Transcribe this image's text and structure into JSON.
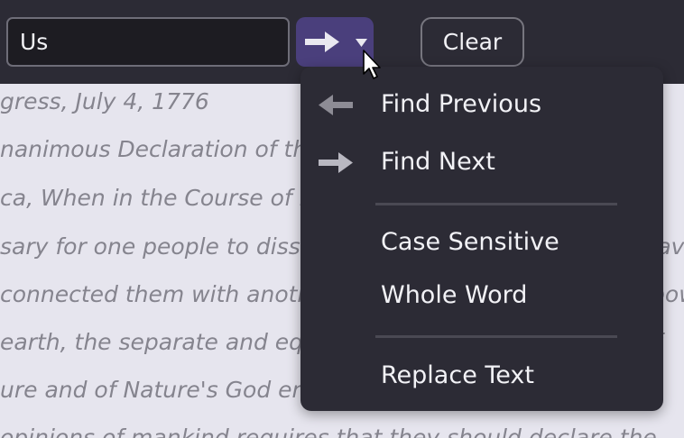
{
  "search": {
    "value": "Us"
  },
  "find_button": {
    "icon": "arrow-right-icon",
    "dropdown_icon": "caret-down-icon"
  },
  "clear_button": {
    "label": "Clear"
  },
  "document": {
    "lines": [
      "gress, July 4, 1776",
      "nanimous Declaration of the thirteen united States of",
      "ca, When in the Course of human events, it becomes",
      "sary for one people to dissolve the political bands which have",
      "connected them with another, and to assume among the powers of the",
      "earth, the separate and equal station to which the Laws of",
      "ure and of Nature's God entitle them, a decent respect",
      "opinions of mankind requires that they should declare the"
    ]
  },
  "menu": {
    "items": [
      {
        "label": "Find Previous",
        "icon": "arrow-left-icon"
      },
      {
        "label": "Find Next",
        "icon": "arrow-right-icon"
      },
      {
        "label": "Case Sensitive",
        "icon": ""
      },
      {
        "label": "Whole Word",
        "icon": ""
      },
      {
        "label": "Replace Text",
        "icon": ""
      }
    ]
  },
  "colors": {
    "toolbar_bg": "#2c2b35",
    "find_button_accent": "#4a3f7c",
    "menu_bg": "#2c2b35",
    "document_bg": "#e6e5ee",
    "document_text": "#85848e"
  }
}
